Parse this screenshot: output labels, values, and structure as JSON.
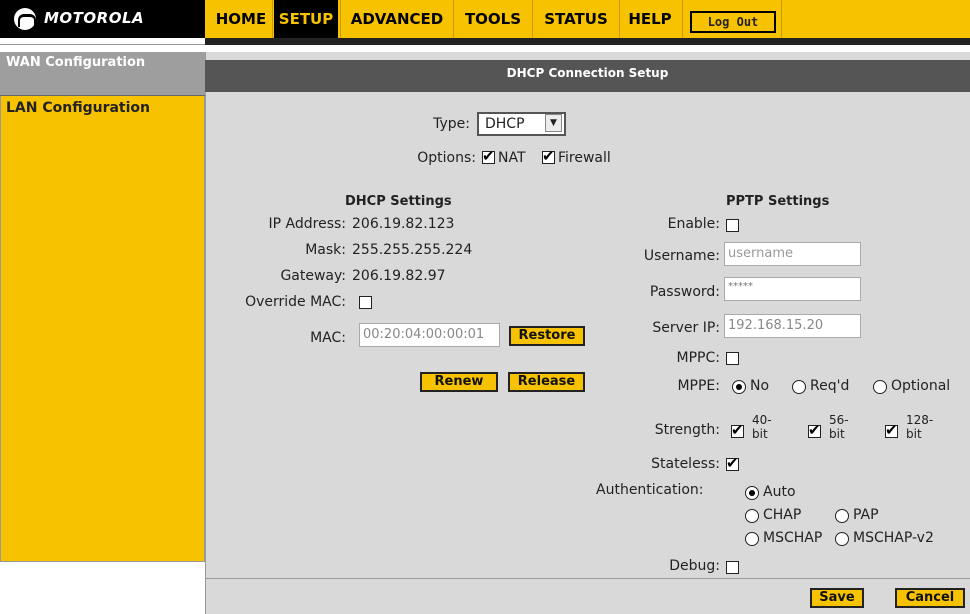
{
  "brand": {
    "logo_text": "MOTOROLA"
  },
  "nav": {
    "items": [
      {
        "label": "HOME"
      },
      {
        "label": "SETUP"
      },
      {
        "label": "ADVANCED"
      },
      {
        "label": "TOOLS"
      },
      {
        "label": "STATUS"
      },
      {
        "label": "HELP"
      }
    ],
    "logout_label": "Log Out",
    "active": "SETUP"
  },
  "sidebar": {
    "items": [
      {
        "label": "WAN Configuration"
      },
      {
        "label": "LAN Configuration"
      }
    ]
  },
  "panel": {
    "title": "DHCP Connection Setup",
    "type_label": "Type:",
    "type_value": "DHCP",
    "options_label": "Options:",
    "nat_label": "NAT",
    "firewall_label": "Firewall",
    "nat_checked": true,
    "firewall_checked": true
  },
  "dhcp": {
    "heading": "DHCP Settings",
    "ip_label": "IP Address:",
    "ip_value": "206.19.82.123",
    "mask_label": "Mask:",
    "mask_value": "255.255.255.224",
    "gateway_label": "Gateway:",
    "gateway_value": "206.19.82.97",
    "override_label": "Override MAC:",
    "override_checked": false,
    "mac_label": "MAC:",
    "mac_value": "00:20:04:00:00:01",
    "restore_label": "Restore",
    "renew_label": "Renew",
    "release_label": "Release"
  },
  "pptp": {
    "heading": "PPTP Settings",
    "enable_label": "Enable:",
    "enable_checked": false,
    "username_label": "Username:",
    "username_placeholder": "username",
    "password_label": "Password:",
    "password_value": "*****",
    "server_label": "Server IP:",
    "server_value": "192.168.15.20",
    "mppc_label": "MPPC:",
    "mppc_checked": false,
    "mppe_label": "MPPE:",
    "mppe_options": [
      "No",
      "Req'd",
      "Optional"
    ],
    "mppe_selected": "No",
    "strength_label": "Strength:",
    "strength_options": [
      {
        "line1": "40-",
        "line2": "bit",
        "checked": true
      },
      {
        "line1": "56-",
        "line2": "bit",
        "checked": true
      },
      {
        "line1": "128-",
        "line2": "bit",
        "checked": true
      }
    ],
    "stateless_label": "Stateless:",
    "stateless_checked": true,
    "auth_label": "Authentication:",
    "auth_options": [
      "Auto",
      "CHAP",
      "PAP",
      "MSCHAP",
      "MSCHAP-v2"
    ],
    "auth_selected": "Auto",
    "debug_label": "Debug:",
    "debug_checked": false
  },
  "footer": {
    "save_label": "Save",
    "cancel_label": "Cancel"
  },
  "colors": {
    "accent": "#f7c200",
    "header_bar": "#555555",
    "panel_bg": "#d9d9d9"
  }
}
